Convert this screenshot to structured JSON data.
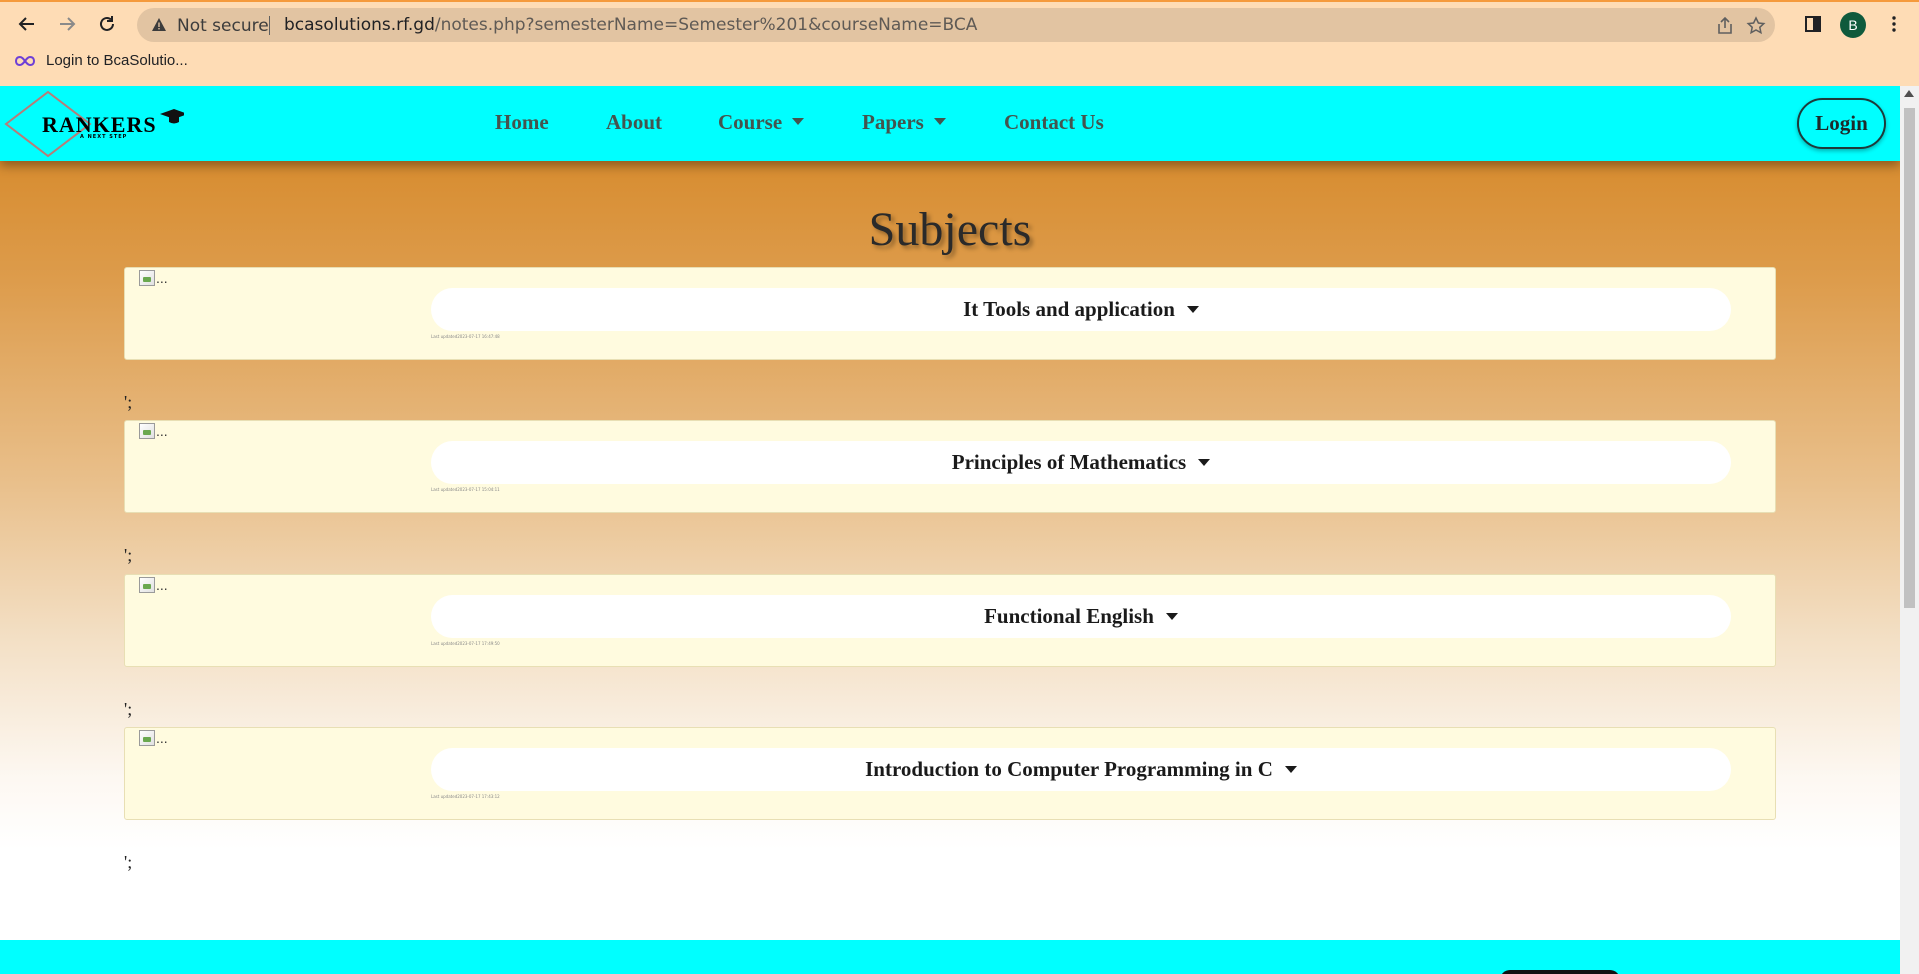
{
  "browser": {
    "security_label": "Not secure",
    "url_host": "bcasolutions.rf.gd",
    "url_path": "/notes.php?semesterName=Semester%201&courseName=BCA",
    "profile_initial": "B",
    "bookmark_label": "Login to BcaSolutio..."
  },
  "navbar": {
    "logo_text": "RANKERS",
    "logo_tagline": "A NEXT STEP",
    "links": [
      "Home",
      "About",
      "Course",
      "Papers",
      "Contact Us"
    ],
    "login_label": "Login"
  },
  "main": {
    "heading": "Subjects",
    "subjects": [
      {
        "name": "It Tools and application",
        "image_alt": "...",
        "updated": "Last updated2023-07-17 16:47:48"
      },
      {
        "name": "Principles of Mathematics",
        "image_alt": "...",
        "updated": "Last updated2023-07-17 15:04:11"
      },
      {
        "name": "Functional English",
        "image_alt": "...",
        "updated": "Last updated2023-07-17 17:49:50"
      },
      {
        "name": "Introduction to Computer Programming in C",
        "image_alt": "...",
        "updated": "Last updated2023-07-17 17:43:12"
      }
    ],
    "stray_text": "';"
  }
}
